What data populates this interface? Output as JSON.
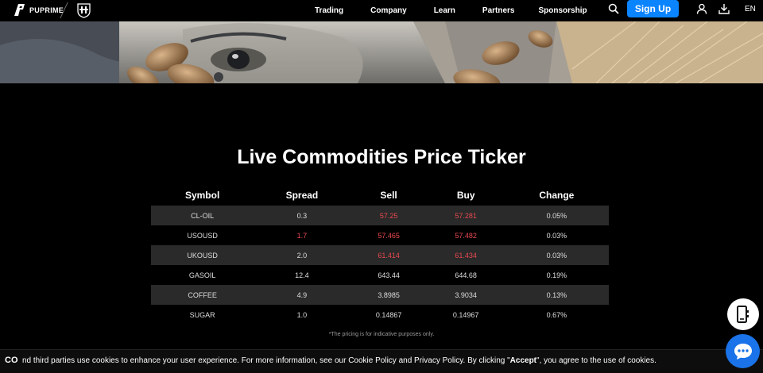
{
  "header": {
    "brand": "PUPRIME",
    "nav": [
      "Trading",
      "Company",
      "Learn",
      "Partners",
      "Sponsorship"
    ],
    "signup_label": "Sign Up",
    "language": "EN"
  },
  "main": {
    "title": "Live Commodities Price Ticker",
    "columns": [
      "Symbol",
      "Spread",
      "Sell",
      "Buy",
      "Change"
    ],
    "rows": [
      {
        "symbol": "CL-OIL",
        "spread": "0.3",
        "sell": "57.25",
        "buy": "57.281",
        "change": "0.05%"
      },
      {
        "symbol": "USOUSD",
        "spread": "1.7",
        "sell": "57.465",
        "buy": "57.482",
        "change": "0.03%"
      },
      {
        "symbol": "UKOUSD",
        "spread": "2.0",
        "sell": "61.414",
        "buy": "61.434",
        "change": "0.03%"
      },
      {
        "symbol": "GASOIL",
        "spread": "12.4",
        "sell": "643.44",
        "buy": "644.68",
        "change": "0.19%"
      },
      {
        "symbol": "COFFEE",
        "spread": "4.9",
        "sell": "3.8985",
        "buy": "3.9034",
        "change": "0.13%"
      },
      {
        "symbol": "SUGAR",
        "spread": "1.0",
        "sell": "0.14867",
        "buy": "0.14967",
        "change": "0.67%"
      }
    ],
    "note": "*The pricing is for indicative purposes only."
  },
  "cookie": {
    "close_label": "CO",
    "text_part1": "nd third parties use cookies to enhance your user experience. For more information, see our Cookie Policy and Privacy Policy. By clicking \"",
    "accept_word": "Accept",
    "text_part2": "\", you agree to the use of cookies."
  },
  "colors": {
    "accent": "#0a84ff",
    "negative": "#e8484f",
    "row_shade": "#2a2a2a",
    "chat_button": "#1a73e8"
  },
  "icons": [
    "search-icon",
    "user-icon",
    "download-icon",
    "app-icon",
    "chat-icon"
  ]
}
